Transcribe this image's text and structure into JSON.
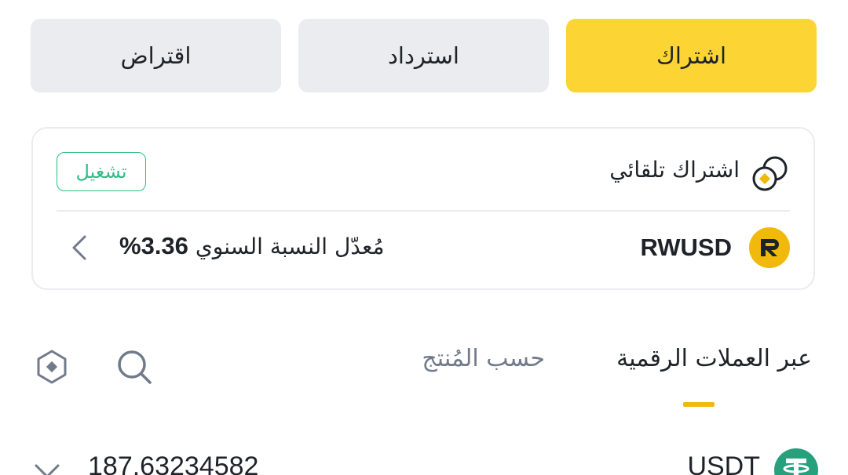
{
  "actions": {
    "subscribe_label": "اشتراك",
    "redeem_label": "استرداد",
    "borrow_label": "اقتراض"
  },
  "auto_subscribe": {
    "label": "اشتراك تلقائي",
    "toggle_label": "تشغيل",
    "icon": "auto-subscribe-icon"
  },
  "product": {
    "coin": "RWUSD",
    "apr_label": "مُعدّل النسبة السنوي",
    "apr_value": "3.36%",
    "coin_icon": "rwusd-logo"
  },
  "tabs": {
    "active_label": "عبر العملات الرقمية",
    "inactive_label": "حسب المُنتج"
  },
  "assets": [
    {
      "name": "USDT",
      "amount": "187.63234582",
      "icon": "usdt-logo"
    }
  ],
  "colors": {
    "accent": "#fcd535",
    "tab_underline": "#f0b90b",
    "toggle_green": "#2ebd85",
    "usdt_green": "#26a17b",
    "button_gray": "#eaecef"
  }
}
